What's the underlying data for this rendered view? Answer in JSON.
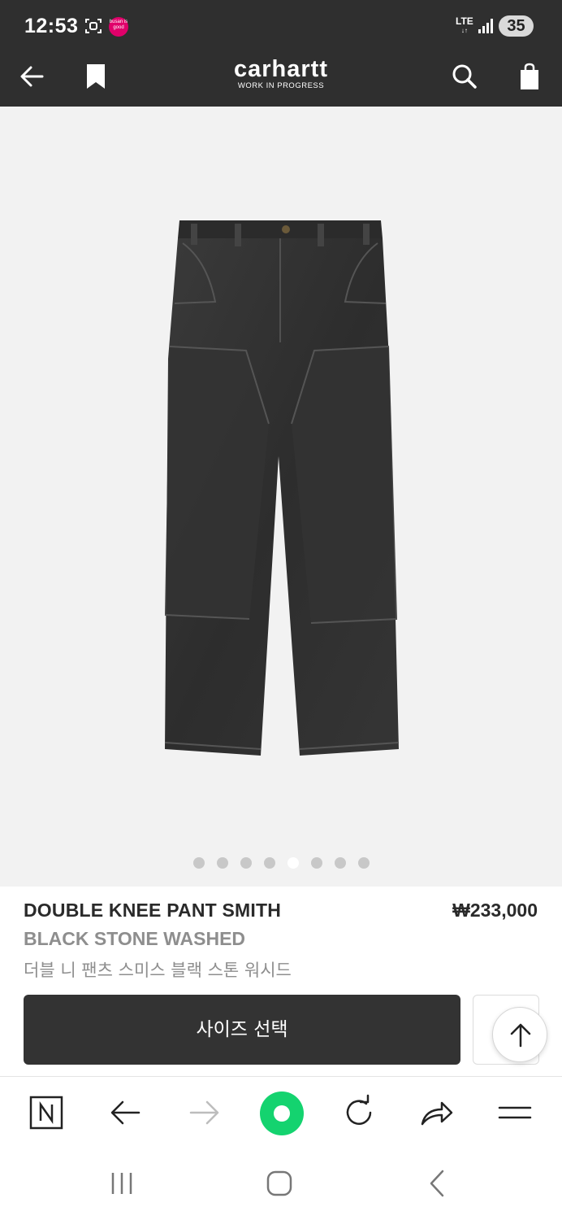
{
  "status_bar": {
    "time": "12:53",
    "app_badge": "busan is good",
    "network": "LTE",
    "battery": "35"
  },
  "header": {
    "logo_main": "carhartt",
    "logo_sub": "WORK IN PROGRESS",
    "icons": [
      "back-arrow-icon",
      "bookmark-icon",
      "search-icon",
      "shopping-bag-icon"
    ]
  },
  "gallery": {
    "image_count": 8,
    "active_index": 4
  },
  "product": {
    "name": "DOUBLE KNEE PANT SMITH",
    "price": "₩233,000",
    "color": "BLACK STONE WASHED",
    "korean_name": "더블 니 팬츠 스미스 블랙 스톤 워시드"
  },
  "actions": {
    "size_select_label": "사이즈 선택"
  },
  "browser_bar": {
    "icons": [
      "naver-n-icon",
      "back-arrow-icon",
      "forward-arrow-icon",
      "home-green-icon",
      "refresh-icon",
      "share-icon",
      "menu-icon"
    ]
  },
  "colors": {
    "dark_header": "#2f2f2f",
    "button": "#333333",
    "accent_green": "#14d36f",
    "muted_text": "#8e8e8e"
  }
}
